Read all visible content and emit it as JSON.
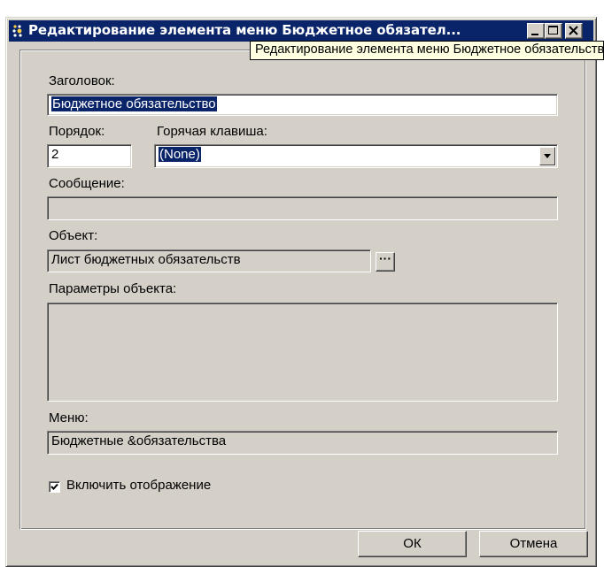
{
  "window": {
    "title": "Редактирование элемента меню Бюджетное обязател...",
    "tooltip": "Редактирование элемента меню Бюджетное обязательство"
  },
  "form": {
    "caption_label": "Заголовок:",
    "caption_value": "Бюджетное обязательство",
    "order_label": "Порядок:",
    "order_value": "2",
    "hotkey_label": "Горячая клавиша:",
    "hotkey_value": "(None)",
    "message_label": "Сообщение:",
    "message_value": "",
    "object_label": "Объект:",
    "object_value": "Лист бюджетных обязательств",
    "object_params_label": "Параметры объекта:",
    "object_params_value": "",
    "menu_label": "Меню:",
    "menu_value": "Бюджетные &обязательства",
    "show_checkbox_label": "Включить отображение",
    "show_checked": true
  },
  "buttons": {
    "ok": "ОК",
    "cancel": "Отмена"
  },
  "colors": {
    "titlebar": "#0a246a",
    "face": "#d4d0c8",
    "tooltip_bg": "#ffffe1",
    "selection": "#0a246a"
  },
  "icons": {
    "title": "menu-item-icon",
    "minimize": "minimize-icon",
    "maximize": "maximize-icon",
    "close": "close-icon",
    "dropdown": "chevron-down-icon",
    "ellipsis": "ellipsis-icon",
    "check": "checkmark-icon"
  }
}
